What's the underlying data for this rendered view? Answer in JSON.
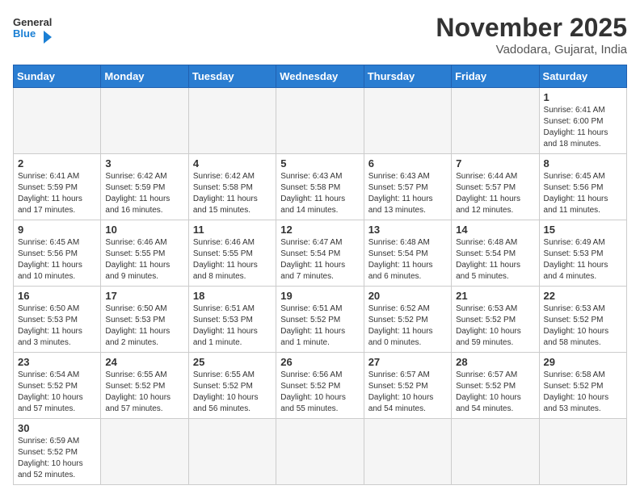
{
  "logo": {
    "general": "General",
    "blue": "Blue"
  },
  "header": {
    "month": "November 2025",
    "location": "Vadodara, Gujarat, India"
  },
  "weekdays": [
    "Sunday",
    "Monday",
    "Tuesday",
    "Wednesday",
    "Thursday",
    "Friday",
    "Saturday"
  ],
  "weeks": [
    [
      {
        "day": "",
        "info": ""
      },
      {
        "day": "",
        "info": ""
      },
      {
        "day": "",
        "info": ""
      },
      {
        "day": "",
        "info": ""
      },
      {
        "day": "",
        "info": ""
      },
      {
        "day": "",
        "info": ""
      },
      {
        "day": "1",
        "info": "Sunrise: 6:41 AM\nSunset: 6:00 PM\nDaylight: 11 hours and 18 minutes."
      }
    ],
    [
      {
        "day": "2",
        "info": "Sunrise: 6:41 AM\nSunset: 5:59 PM\nDaylight: 11 hours and 17 minutes."
      },
      {
        "day": "3",
        "info": "Sunrise: 6:42 AM\nSunset: 5:59 PM\nDaylight: 11 hours and 16 minutes."
      },
      {
        "day": "4",
        "info": "Sunrise: 6:42 AM\nSunset: 5:58 PM\nDaylight: 11 hours and 15 minutes."
      },
      {
        "day": "5",
        "info": "Sunrise: 6:43 AM\nSunset: 5:58 PM\nDaylight: 11 hours and 14 minutes."
      },
      {
        "day": "6",
        "info": "Sunrise: 6:43 AM\nSunset: 5:57 PM\nDaylight: 11 hours and 13 minutes."
      },
      {
        "day": "7",
        "info": "Sunrise: 6:44 AM\nSunset: 5:57 PM\nDaylight: 11 hours and 12 minutes."
      },
      {
        "day": "8",
        "info": "Sunrise: 6:45 AM\nSunset: 5:56 PM\nDaylight: 11 hours and 11 minutes."
      }
    ],
    [
      {
        "day": "9",
        "info": "Sunrise: 6:45 AM\nSunset: 5:56 PM\nDaylight: 11 hours and 10 minutes."
      },
      {
        "day": "10",
        "info": "Sunrise: 6:46 AM\nSunset: 5:55 PM\nDaylight: 11 hours and 9 minutes."
      },
      {
        "day": "11",
        "info": "Sunrise: 6:46 AM\nSunset: 5:55 PM\nDaylight: 11 hours and 8 minutes."
      },
      {
        "day": "12",
        "info": "Sunrise: 6:47 AM\nSunset: 5:54 PM\nDaylight: 11 hours and 7 minutes."
      },
      {
        "day": "13",
        "info": "Sunrise: 6:48 AM\nSunset: 5:54 PM\nDaylight: 11 hours and 6 minutes."
      },
      {
        "day": "14",
        "info": "Sunrise: 6:48 AM\nSunset: 5:54 PM\nDaylight: 11 hours and 5 minutes."
      },
      {
        "day": "15",
        "info": "Sunrise: 6:49 AM\nSunset: 5:53 PM\nDaylight: 11 hours and 4 minutes."
      }
    ],
    [
      {
        "day": "16",
        "info": "Sunrise: 6:50 AM\nSunset: 5:53 PM\nDaylight: 11 hours and 3 minutes."
      },
      {
        "day": "17",
        "info": "Sunrise: 6:50 AM\nSunset: 5:53 PM\nDaylight: 11 hours and 2 minutes."
      },
      {
        "day": "18",
        "info": "Sunrise: 6:51 AM\nSunset: 5:53 PM\nDaylight: 11 hours and 1 minute."
      },
      {
        "day": "19",
        "info": "Sunrise: 6:51 AM\nSunset: 5:52 PM\nDaylight: 11 hours and 1 minute."
      },
      {
        "day": "20",
        "info": "Sunrise: 6:52 AM\nSunset: 5:52 PM\nDaylight: 11 hours and 0 minutes."
      },
      {
        "day": "21",
        "info": "Sunrise: 6:53 AM\nSunset: 5:52 PM\nDaylight: 10 hours and 59 minutes."
      },
      {
        "day": "22",
        "info": "Sunrise: 6:53 AM\nSunset: 5:52 PM\nDaylight: 10 hours and 58 minutes."
      }
    ],
    [
      {
        "day": "23",
        "info": "Sunrise: 6:54 AM\nSunset: 5:52 PM\nDaylight: 10 hours and 57 minutes."
      },
      {
        "day": "24",
        "info": "Sunrise: 6:55 AM\nSunset: 5:52 PM\nDaylight: 10 hours and 57 minutes."
      },
      {
        "day": "25",
        "info": "Sunrise: 6:55 AM\nSunset: 5:52 PM\nDaylight: 10 hours and 56 minutes."
      },
      {
        "day": "26",
        "info": "Sunrise: 6:56 AM\nSunset: 5:52 PM\nDaylight: 10 hours and 55 minutes."
      },
      {
        "day": "27",
        "info": "Sunrise: 6:57 AM\nSunset: 5:52 PM\nDaylight: 10 hours and 54 minutes."
      },
      {
        "day": "28",
        "info": "Sunrise: 6:57 AM\nSunset: 5:52 PM\nDaylight: 10 hours and 54 minutes."
      },
      {
        "day": "29",
        "info": "Sunrise: 6:58 AM\nSunset: 5:52 PM\nDaylight: 10 hours and 53 minutes."
      }
    ],
    [
      {
        "day": "30",
        "info": "Sunrise: 6:59 AM\nSunset: 5:52 PM\nDaylight: 10 hours and 52 minutes."
      },
      {
        "day": "",
        "info": ""
      },
      {
        "day": "",
        "info": ""
      },
      {
        "day": "",
        "info": ""
      },
      {
        "day": "",
        "info": ""
      },
      {
        "day": "",
        "info": ""
      },
      {
        "day": "",
        "info": ""
      }
    ]
  ]
}
